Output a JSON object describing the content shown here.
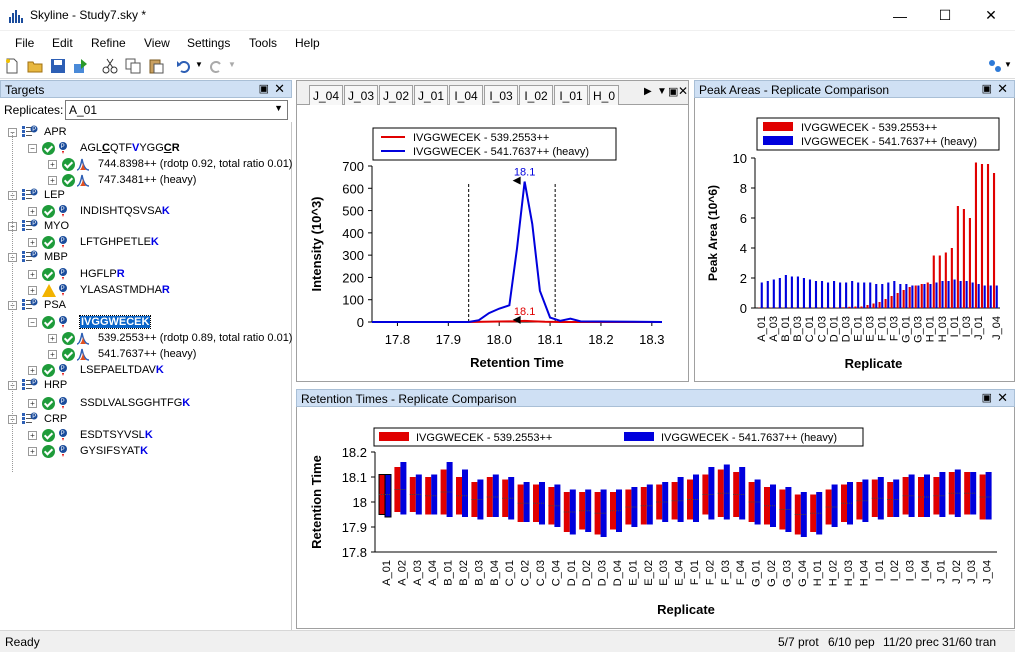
{
  "window": {
    "title": "Skyline - Study7.sky *"
  },
  "menu": [
    "File",
    "Edit",
    "Refine",
    "View",
    "Settings",
    "Tools",
    "Help"
  ],
  "targets": {
    "title": "Targets",
    "replicates_label": "Replicates:",
    "replicate_value": "A_01",
    "tree": [
      {
        "kind": "protein",
        "label": "APR"
      },
      {
        "kind": "peptide",
        "label": "AGLCQTFVYGGCR",
        "parts": [
          "AGL",
          "C",
          "QTF",
          "V",
          "YGG",
          "C",
          "R"
        ]
      },
      {
        "kind": "transition",
        "label": "744.8398++ (rdotp 0.92, total ratio 0.01)"
      },
      {
        "kind": "transition",
        "label": "747.3481++ (heavy)"
      },
      {
        "kind": "protein",
        "label": "LEP"
      },
      {
        "kind": "peptide",
        "label": "INDISHTQSVSAK",
        "plain": "INDISHTQSVSA",
        "heavy": "K"
      },
      {
        "kind": "protein",
        "label": "MYO"
      },
      {
        "kind": "peptide",
        "label": "LFTGHPETLEK",
        "plain": "LFTGHPETLE",
        "heavy": "K"
      },
      {
        "kind": "protein",
        "label": "MBP"
      },
      {
        "kind": "peptide",
        "label": "HGFLPR",
        "plain": "HGFLP",
        "heavy": "R"
      },
      {
        "kind": "peptide",
        "label": "YLASASTMDHAR",
        "plain": "YLASASTMDHA",
        "heavy": "R",
        "warning": true
      },
      {
        "kind": "protein",
        "label": "PSA"
      },
      {
        "kind": "peptide",
        "label": "IVGGWECEK",
        "selected": true
      },
      {
        "kind": "transition",
        "label": "539.2553++ (rdotp 0.89, total ratio 0.01)"
      },
      {
        "kind": "transition",
        "label": "541.7637++ (heavy)"
      },
      {
        "kind": "peptide",
        "label": "LSEPAELTDAVK",
        "plain": "LSEPAELTDAV",
        "heavy": "K"
      },
      {
        "kind": "protein",
        "label": "HRP"
      },
      {
        "kind": "peptide",
        "label": "SSDLVALSGGHTFGK",
        "plain": "SSDLVALSGGHTFG",
        "heavy": "K"
      },
      {
        "kind": "protein",
        "label": "CRP"
      },
      {
        "kind": "peptide",
        "label": "ESDTSYVSLK",
        "plain": "ESDTSYVSL",
        "heavy": "K"
      },
      {
        "kind": "peptide",
        "label": "GYSIFSYATK",
        "plain": "GYSIFSYAT",
        "heavy": "K"
      }
    ]
  },
  "chromatogram": {
    "tabs": [
      "J_04",
      "J_03",
      "J_02",
      "J_01",
      "I_04",
      "I_03",
      "I_02",
      "I_01",
      "H_0"
    ],
    "legend": [
      "IVGGWECEK - 539.2553++",
      "IVGGWECEK - 541.7637++ (heavy)"
    ],
    "colors": {
      "light": "#e00000",
      "heavy": "#0000dd"
    }
  },
  "peak_areas": {
    "title": "Peak Areas - Replicate Comparison",
    "legend": [
      "IVGGWECEK - 539.2553++",
      "IVGGWECEK - 541.7637++ (heavy)"
    ]
  },
  "retention_times": {
    "title": "Retention Times - Replicate Comparison",
    "legend": [
      "IVGGWECEK - 539.2553++",
      "IVGGWECEK - 541.7637++ (heavy)"
    ]
  },
  "status": {
    "ready": "Ready",
    "prot": "5/7 prot",
    "pep": "6/10 pep",
    "prec": "11/20 prec",
    "tran": "31/60 tran"
  },
  "chart_data": [
    {
      "type": "line",
      "title": "",
      "xlabel": "Retention Time",
      "ylabel": "Intensity (10^3)",
      "xlim": [
        17.75,
        18.32
      ],
      "ylim": [
        0,
        700
      ],
      "xticks": [
        "17.8",
        "17.9",
        "18.0",
        "18.1",
        "18.2",
        "18.3"
      ],
      "yticks": [
        "0",
        "100",
        "200",
        "300",
        "400",
        "500",
        "600",
        "700"
      ],
      "integration_bounds": [
        17.94,
        18.11
      ],
      "series": [
        {
          "name": "IVGGWECEK - 539.2553++",
          "x": [
            17.75,
            17.94,
            17.97,
            18.0,
            18.03,
            18.05,
            18.07,
            18.09,
            18.12,
            18.32
          ],
          "y": [
            0,
            0,
            1,
            2,
            3,
            5,
            3,
            1,
            0,
            0
          ],
          "peak_label": "18.1"
        },
        {
          "name": "IVGGWECEK - 541.7637++ (heavy)",
          "x": [
            17.75,
            17.94,
            17.96,
            17.98,
            18.0,
            18.02,
            18.035,
            18.05,
            18.065,
            18.08,
            18.1,
            18.12,
            18.14,
            18.16,
            18.32
          ],
          "y": [
            0,
            0,
            8,
            40,
            60,
            75,
            330,
            630,
            440,
            140,
            20,
            5,
            15,
            3,
            0
          ],
          "peak_label": "18.1"
        }
      ]
    },
    {
      "type": "bar",
      "title": "",
      "xlabel": "Replicate",
      "ylabel": "Peak Area (10^6)",
      "ylim": [
        0,
        10
      ],
      "yticks": [
        "0",
        "2",
        "4",
        "6",
        "8",
        "10"
      ],
      "categories": [
        "A_01",
        "A_02",
        "A_03",
        "A_04",
        "B_01",
        "B_02",
        "B_03",
        "B_04",
        "C_01",
        "C_02",
        "C_03",
        "C_04",
        "D_01",
        "D_02",
        "D_03",
        "D_04",
        "E_01",
        "E_02",
        "E_03",
        "E_04",
        "F_01",
        "F_02",
        "F_03",
        "F_04",
        "G_01",
        "G_02",
        "G_03",
        "G_04",
        "H_01",
        "H_02",
        "H_03",
        "H_04",
        "I_01",
        "I_02",
        "I_03",
        "I_04",
        "J_01",
        "J_02",
        "J_03",
        "J_04"
      ],
      "xtick_labels": [
        "A_01",
        "A_03",
        "B_01",
        "B_03",
        "C_01",
        "C_03",
        "D_01",
        "D_03",
        "E_01",
        "E_03",
        "F_01",
        "F_03",
        "G_01",
        "G_03",
        "H_01",
        "H_03",
        "I_01",
        "I_03",
        "J_01",
        "J_04"
      ],
      "series": [
        {
          "name": "IVGGWECEK - 539.2553++",
          "values": [
            0.02,
            0.02,
            0.02,
            0.02,
            0.02,
            0.02,
            0.02,
            0.02,
            0.02,
            0.02,
            0.02,
            0.03,
            0.03,
            0.03,
            0.05,
            0.08,
            0.1,
            0.1,
            0.2,
            0.3,
            0.4,
            0.6,
            0.8,
            1.0,
            1.2,
            1.4,
            1.5,
            1.6,
            1.7,
            3.5,
            3.5,
            3.7,
            4.0,
            6.8,
            6.6,
            6.0,
            9.7,
            9.6,
            9.6,
            9.0
          ]
        },
        {
          "name": "IVGGWECEK - 541.7637++ (heavy)",
          "values": [
            1.7,
            1.8,
            1.9,
            2.0,
            2.2,
            2.1,
            2.1,
            2.0,
            1.9,
            1.8,
            1.8,
            1.7,
            1.8,
            1.7,
            1.7,
            1.8,
            1.7,
            1.7,
            1.7,
            1.6,
            1.6,
            1.7,
            1.8,
            1.6,
            1.6,
            1.5,
            1.5,
            1.6,
            1.6,
            1.7,
            1.8,
            1.8,
            1.9,
            1.8,
            1.8,
            1.7,
            1.6,
            1.5,
            1.5,
            1.5
          ]
        }
      ]
    },
    {
      "type": "bar",
      "title": "",
      "xlabel": "Replicate",
      "ylabel": "Retention Time",
      "ylim": [
        17.8,
        18.2
      ],
      "yticks": [
        "17.8",
        "17.9",
        "18",
        "18.1",
        "18.2"
      ],
      "categories": [
        "A_01",
        "A_02",
        "A_03",
        "A_04",
        "B_01",
        "B_02",
        "B_03",
        "B_04",
        "C_01",
        "C_02",
        "C_03",
        "C_04",
        "D_01",
        "D_02",
        "D_03",
        "D_04",
        "E_01",
        "E_02",
        "E_03",
        "E_04",
        "F_01",
        "F_02",
        "F_03",
        "F_04",
        "G_01",
        "G_02",
        "G_03",
        "G_04",
        "H_01",
        "H_02",
        "H_03",
        "H_04",
        "I_01",
        "I_02",
        "I_03",
        "I_04",
        "J_01",
        "J_02",
        "J_03",
        "J_04"
      ],
      "series": [
        {
          "name": "IVGGWECEK - 539.2553++",
          "low": [
            17.95,
            17.96,
            17.96,
            17.95,
            17.95,
            17.95,
            17.94,
            17.94,
            17.94,
            17.92,
            17.92,
            17.91,
            17.88,
            17.89,
            17.87,
            17.89,
            17.91,
            17.91,
            17.93,
            17.93,
            17.93,
            17.95,
            17.94,
            17.94,
            17.92,
            17.91,
            17.89,
            17.87,
            17.88,
            17.91,
            17.92,
            17.93,
            17.94,
            17.94,
            17.95,
            17.94,
            17.95,
            17.95,
            17.95,
            17.93
          ],
          "high": [
            18.11,
            18.14,
            18.1,
            18.1,
            18.13,
            18.1,
            18.08,
            18.1,
            18.09,
            18.07,
            18.07,
            18.06,
            18.04,
            18.04,
            18.04,
            18.04,
            18.05,
            18.06,
            18.07,
            18.08,
            18.09,
            18.11,
            18.13,
            18.12,
            18.08,
            18.06,
            18.05,
            18.03,
            18.03,
            18.05,
            18.07,
            18.08,
            18.09,
            18.08,
            18.1,
            18.1,
            18.1,
            18.12,
            18.12,
            18.11
          ]
        },
        {
          "name": "IVGGWECEK - 541.7637++ (heavy)",
          "low": [
            17.94,
            17.95,
            17.95,
            17.95,
            17.94,
            17.94,
            17.93,
            17.94,
            17.93,
            17.92,
            17.91,
            17.9,
            17.87,
            17.88,
            17.86,
            17.88,
            17.9,
            17.91,
            17.92,
            17.92,
            17.92,
            17.93,
            17.93,
            17.93,
            17.91,
            17.9,
            17.88,
            17.86,
            17.87,
            17.9,
            17.91,
            17.92,
            17.93,
            17.94,
            17.94,
            17.94,
            17.94,
            17.94,
            17.95,
            17.93
          ],
          "high": [
            18.11,
            18.16,
            18.11,
            18.11,
            18.16,
            18.13,
            18.09,
            18.11,
            18.1,
            18.08,
            18.08,
            18.07,
            18.05,
            18.05,
            18.05,
            18.05,
            18.06,
            18.07,
            18.08,
            18.1,
            18.11,
            18.14,
            18.15,
            18.14,
            18.09,
            18.07,
            18.06,
            18.04,
            18.04,
            18.07,
            18.08,
            18.09,
            18.1,
            18.09,
            18.11,
            18.11,
            18.12,
            18.13,
            18.12,
            18.12
          ]
        }
      ]
    }
  ]
}
